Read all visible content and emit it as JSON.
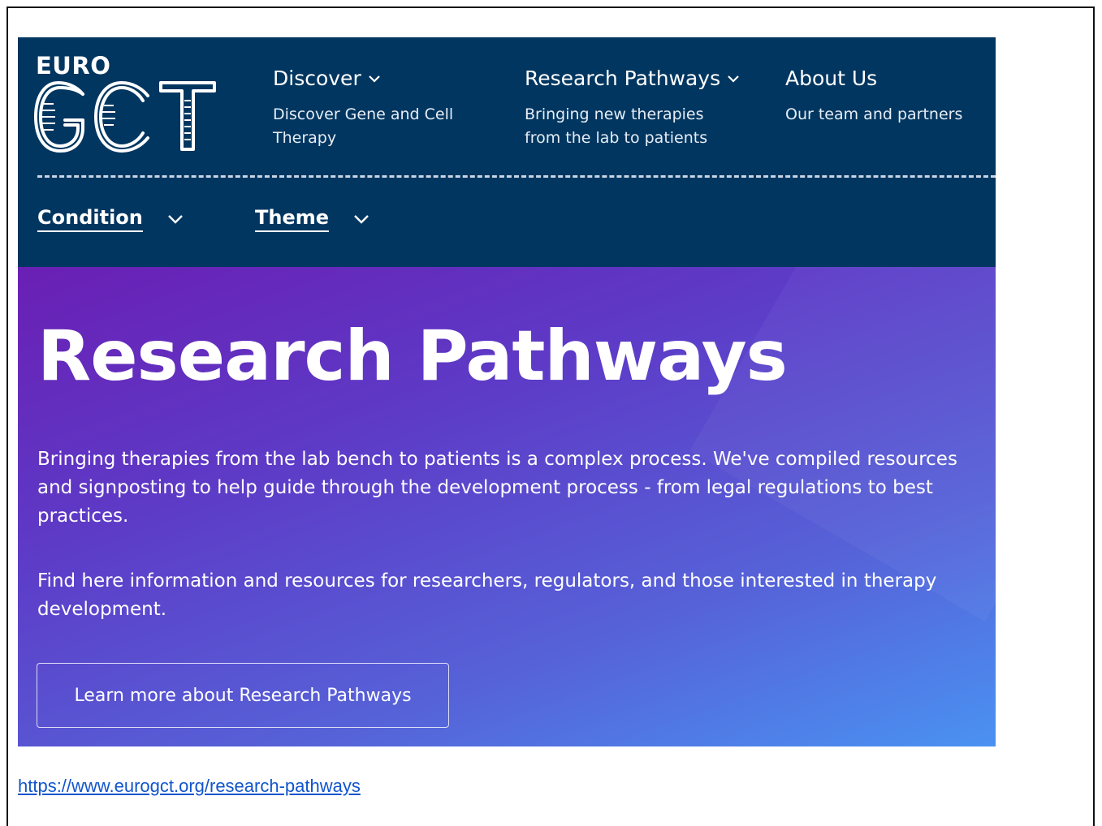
{
  "logo": {
    "top_text": "EURO",
    "main_text": "GCT"
  },
  "nav": [
    {
      "title": "Discover",
      "subtitle": "Discover Gene and Cell Therapy",
      "has_dropdown": true
    },
    {
      "title": "Research Pathways",
      "subtitle": "Bringing new therapies from the lab to patients",
      "has_dropdown": true
    },
    {
      "title": "About Us",
      "subtitle": "Our team and partners",
      "has_dropdown": false
    }
  ],
  "filters": [
    {
      "label": "Condition"
    },
    {
      "label": "Theme"
    }
  ],
  "hero": {
    "title": "Research Pathways",
    "paragraph_1": "Bringing therapies from the lab bench to patients is a complex process. We've compiled resources and signposting to help guide through the development process - from legal regulations to best practices.",
    "paragraph_2": "Find here information and resources for researchers, regulators, and those interested in therapy development.",
    "cta_label": "Learn more about Research Pathways"
  },
  "caption": {
    "url": "https://www.eurogct.org/research-pathways"
  },
  "colors": {
    "header_bg": "#013660",
    "hero_gradient_start": "#6a1fb4",
    "hero_gradient_end": "#4a92f2",
    "link": "#1155cc"
  },
  "icons": [
    "chevron-down-icon",
    "logo-gct-icon"
  ]
}
